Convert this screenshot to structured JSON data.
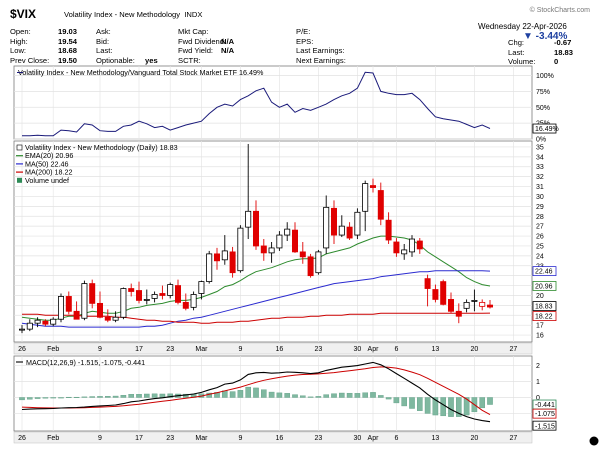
{
  "header": {
    "ticker": "$VIX",
    "name": "Volatility Index - New Methodology",
    "exchange": "INDX",
    "copyright": "© StockCharts.com",
    "date": "Wednesday  22-Apr-2026",
    "change_pct": "▼ -3.44%",
    "col1": [
      [
        "Open:",
        "19.03"
      ],
      [
        "High:",
        "19.54"
      ],
      [
        "Low:",
        "18.68"
      ],
      [
        "Prev Close:",
        "19.50"
      ]
    ],
    "col2": [
      [
        "Ask:",
        ""
      ],
      [
        "Bid:",
        ""
      ],
      [
        "Last:",
        ""
      ],
      [
        "Optionable:",
        "yes"
      ]
    ],
    "col3": [
      [
        "Mkt Cap:",
        ""
      ],
      [
        "Fwd Dividend:",
        "N/A"
      ],
      [
        "Fwd Yield:",
        "N/A"
      ],
      [
        "SCTR:",
        ""
      ]
    ],
    "col4": [
      [
        "P/E:",
        ""
      ],
      [
        "EPS:",
        ""
      ],
      [
        "Last Earnings:",
        ""
      ],
      [
        "Next Earnings:",
        ""
      ]
    ],
    "col5": [
      [
        "Chg:",
        "-0.67"
      ],
      [
        "Last:",
        "18.83"
      ],
      [
        "Volume:",
        "0"
      ]
    ]
  },
  "ratio_panel": {
    "legend": "Volatility Index - New Methodology/Vanguard Total Stock Market ETF 16.49%",
    "ticks": [
      "100%",
      "75%",
      "50%",
      "25%",
      "0%"
    ],
    "last_label": "16.49%"
  },
  "price_panel": {
    "legend": [
      "Volatility Index - New Methodology (Daily) 18.83",
      "EMA(20) 20.96",
      "MA(50) 22.46",
      "MA(200) 18.22",
      "Volume undef"
    ],
    "legend_colors": [
      "#000000",
      "#2e8b2e",
      "#2b2bd0",
      "#cc0000",
      "#2e8b57"
    ],
    "ticks": [
      "35",
      "34",
      "33",
      "32",
      "31",
      "30",
      "29",
      "28",
      "27",
      "26",
      "25",
      "24",
      "23",
      "22",
      "21",
      "20",
      "19",
      "18",
      "17",
      "16"
    ],
    "badges": [
      {
        "text": "22.46",
        "color": "#2b2bd0",
        "y": 22.46
      },
      {
        "text": "20.96",
        "color": "#2e8b2e",
        "y": 20.96
      },
      {
        "text": "18.83",
        "color": "#000000",
        "y": 18.83
      },
      {
        "text": "18.22",
        "color": "#cc0000",
        "y": 18.22
      }
    ]
  },
  "macd_panel": {
    "legend": [
      "MACD(12,26,9) -1.515, ",
      "-1.075, ",
      "-0.441"
    ],
    "legend_colors": [
      "#000000",
      "#cc0000",
      "#2e8b57"
    ],
    "ticks": [
      "2",
      "1",
      "0",
      "-1"
    ],
    "badges": [
      {
        "text": "-0.441",
        "color": "#2e8b57",
        "y": -0.441
      },
      {
        "text": "-1.075",
        "color": "#cc0000",
        "y": -1.075
      },
      {
        "text": "-1.515",
        "color": "#000000",
        "y": -1.515
      }
    ]
  },
  "x_axis": {
    "labels": [
      "26",
      "Feb",
      "9",
      "17",
      "23",
      "Mar",
      "9",
      "16",
      "23",
      "30",
      "Apr",
      "6",
      "13",
      "20",
      "27"
    ],
    "label_positions": [
      0,
      4,
      10,
      15,
      19,
      23,
      28,
      33,
      38,
      43,
      45,
      48,
      53,
      58,
      63
    ]
  },
  "chart_data": {
    "type": "candlestick",
    "title": "Volatility Index - New Methodology (Daily)",
    "ylim": [
      15.3,
      35.6
    ],
    "x": [
      "2026-01-26",
      "2026-01-27",
      "2026-01-28",
      "2026-01-29",
      "2026-01-30",
      "2026-02-02",
      "2026-02-03",
      "2026-02-04",
      "2026-02-05",
      "2026-02-06",
      "2026-02-09",
      "2026-02-10",
      "2026-02-11",
      "2026-02-12",
      "2026-02-13",
      "2026-02-17",
      "2026-02-18",
      "2026-02-19",
      "2026-02-20",
      "2026-02-23",
      "2026-02-24",
      "2026-02-25",
      "2026-02-26",
      "2026-02-27",
      "2026-03-02",
      "2026-03-03",
      "2026-03-04",
      "2026-03-05",
      "2026-03-06",
      "2026-03-09",
      "2026-03-10",
      "2026-03-11",
      "2026-03-12",
      "2026-03-13",
      "2026-03-16",
      "2026-03-17",
      "2026-03-18",
      "2026-03-19",
      "2026-03-20",
      "2026-03-23",
      "2026-03-24",
      "2026-03-25",
      "2026-03-26",
      "2026-03-27",
      "2026-03-30",
      "2026-03-31",
      "2026-04-01",
      "2026-04-02",
      "2026-04-06",
      "2026-04-07",
      "2026-04-08",
      "2026-04-09",
      "2026-04-10",
      "2026-04-13",
      "2026-04-14",
      "2026-04-15",
      "2026-04-16",
      "2026-04-17",
      "2026-04-20",
      "2026-04-21",
      "2026-04-22"
    ],
    "ohlc": [
      [
        16.5,
        17.0,
        16.2,
        16.6
      ],
      [
        16.6,
        17.6,
        16.4,
        17.2
      ],
      [
        17.2,
        17.8,
        16.8,
        17.5
      ],
      [
        17.4,
        17.6,
        16.9,
        17.1
      ],
      [
        17.1,
        17.8,
        16.9,
        17.6
      ],
      [
        17.6,
        20.2,
        17.3,
        19.9
      ],
      [
        19.9,
        20.4,
        18.1,
        18.4
      ],
      [
        18.4,
        19.4,
        17.6,
        17.6
      ],
      [
        17.7,
        21.5,
        17.5,
        21.2
      ],
      [
        21.2,
        21.6,
        18.7,
        19.2
      ],
      [
        19.2,
        20.4,
        17.7,
        17.8
      ],
      [
        17.8,
        18.6,
        17.3,
        17.5
      ],
      [
        17.5,
        18.4,
        17.3,
        17.8
      ],
      [
        17.8,
        20.8,
        17.6,
        20.7
      ],
      [
        20.7,
        21.2,
        19.9,
        20.4
      ],
      [
        20.5,
        21.4,
        19.2,
        19.5
      ],
      [
        19.5,
        20.6,
        19.1,
        19.6
      ],
      [
        19.7,
        20.4,
        19.3,
        20.1
      ],
      [
        20.2,
        21.0,
        19.6,
        20.0
      ],
      [
        20.0,
        21.3,
        19.7,
        21.1
      ],
      [
        21.0,
        21.6,
        19.1,
        19.3
      ],
      [
        19.3,
        20.2,
        18.5,
        18.7
      ],
      [
        18.8,
        20.4,
        18.5,
        20.1
      ],
      [
        20.2,
        21.5,
        19.6,
        21.4
      ],
      [
        21.4,
        24.5,
        21.2,
        24.2
      ],
      [
        24.2,
        24.8,
        22.6,
        23.5
      ],
      [
        23.6,
        26.1,
        23.1,
        24.5
      ],
      [
        24.4,
        24.9,
        21.8,
        22.3
      ],
      [
        22.5,
        27.1,
        22.3,
        26.8
      ],
      [
        26.9,
        35.3,
        25.7,
        28.5
      ],
      [
        28.5,
        29.6,
        24.6,
        25.0
      ],
      [
        25.0,
        25.7,
        23.5,
        24.3
      ],
      [
        24.3,
        25.4,
        23.3,
        24.8
      ],
      [
        24.8,
        26.5,
        24.5,
        26.1
      ],
      [
        26.1,
        27.4,
        25.5,
        26.7
      ],
      [
        26.6,
        27.4,
        24.3,
        24.4
      ],
      [
        24.4,
        25.4,
        23.2,
        23.9
      ],
      [
        23.9,
        24.2,
        21.8,
        22.0
      ],
      [
        22.3,
        24.6,
        22.1,
        24.4
      ],
      [
        24.8,
        30.1,
        24.2,
        28.9
      ],
      [
        28.8,
        29.6,
        25.2,
        26.1
      ],
      [
        26.1,
        28.1,
        25.9,
        27.0
      ],
      [
        26.9,
        27.4,
        25.6,
        25.8
      ],
      [
        26.1,
        28.8,
        25.7,
        28.4
      ],
      [
        28.5,
        31.6,
        26.5,
        31.3
      ],
      [
        31.1,
        31.8,
        30.4,
        30.9
      ],
      [
        30.6,
        31.4,
        27.1,
        27.7
      ],
      [
        27.6,
        28.4,
        25.2,
        25.6
      ],
      [
        25.4,
        25.8,
        23.9,
        24.3
      ],
      [
        24.2,
        25.2,
        23.6,
        24.6
      ],
      [
        24.4,
        26.1,
        23.9,
        25.7
      ],
      [
        25.5,
        25.8,
        24.2,
        24.7
      ],
      [
        21.7,
        22.1,
        18.9,
        20.7
      ],
      [
        20.6,
        21.1,
        19.3,
        19.6
      ],
      [
        21.4,
        21.6,
        19.0,
        19.1
      ],
      [
        19.6,
        20.3,
        18.2,
        18.4
      ],
      [
        18.4,
        19.2,
        17.2,
        17.9
      ],
      [
        18.7,
        19.6,
        18.3,
        19.3
      ],
      [
        19.4,
        20.6,
        18.4,
        19.5
      ],
      [
        18.9,
        19.6,
        18.5,
        19.3
      ],
      [
        19.03,
        19.54,
        18.68,
        18.83
      ]
    ],
    "series": [
      {
        "name": "EMA(20)",
        "values": [
          17.8,
          17.7,
          17.6,
          17.5,
          17.5,
          17.7,
          17.9,
          17.9,
          18.2,
          18.4,
          18.3,
          18.2,
          18.2,
          18.4,
          18.7,
          18.8,
          19.0,
          19.1,
          19.2,
          19.4,
          19.5,
          19.5,
          19.6,
          19.8,
          20.1,
          20.4,
          20.9,
          21.1,
          21.5,
          22.0,
          22.4,
          22.6,
          22.8,
          23.1,
          23.4,
          23.6,
          23.7,
          23.7,
          23.8,
          24.2,
          24.4,
          24.6,
          24.8,
          25.2,
          25.5,
          25.8,
          26.0,
          26.0,
          25.9,
          25.8,
          25.6,
          25.1,
          24.4,
          23.9,
          23.4,
          22.9,
          22.4,
          21.8,
          21.4,
          21.1,
          20.96
        ]
      },
      {
        "name": "MA(50)",
        "values": [
          17.2,
          17.1,
          17.0,
          16.9,
          16.9,
          16.9,
          16.8,
          16.8,
          16.8,
          16.8,
          16.8,
          16.8,
          16.8,
          16.8,
          16.8,
          16.8,
          16.9,
          16.9,
          17.0,
          17.2,
          17.4,
          17.5,
          17.7,
          17.8,
          18.0,
          18.2,
          18.4,
          18.6,
          18.8,
          19.0,
          19.2,
          19.4,
          19.6,
          19.8,
          20.0,
          20.2,
          20.4,
          20.6,
          20.8,
          21.0,
          21.2,
          21.3,
          21.4,
          21.5,
          21.6,
          21.7,
          21.9,
          22.0,
          22.1,
          22.2,
          22.3,
          22.4,
          22.4,
          22.5,
          22.5,
          22.5,
          22.5,
          22.5,
          22.5,
          22.5,
          22.46
        ]
      },
      {
        "name": "MA(200)",
        "values": [
          18.1,
          18.1,
          18.1,
          18.0,
          18.0,
          18.0,
          18.0,
          18.0,
          17.9,
          17.9,
          17.9,
          17.9,
          17.8,
          17.8,
          17.7,
          17.6,
          17.5,
          17.5,
          17.4,
          17.4,
          17.3,
          17.3,
          17.3,
          17.2,
          17.2,
          17.3,
          17.3,
          17.3,
          17.4,
          17.4,
          17.5,
          17.6,
          17.7,
          17.7,
          17.8,
          17.8,
          17.8,
          17.9,
          17.9,
          18.0,
          18.0,
          18.0,
          18.1,
          18.1,
          18.1,
          18.1,
          18.2,
          18.2,
          18.2,
          18.2,
          18.2,
          18.2,
          18.2,
          18.2,
          18.2,
          18.2,
          18.2,
          18.2,
          18.2,
          18.2,
          18.22
        ]
      }
    ],
    "ratio": {
      "name": "Volatility Index - New Methodology/Vanguard Total Stock Market ETF",
      "unit": "%",
      "ylim": [
        0,
        115
      ],
      "values": [
        5,
        5,
        6,
        5,
        5,
        14,
        13,
        11,
        24,
        22,
        13,
        12,
        12,
        20,
        22,
        28,
        24,
        18,
        20,
        14,
        18,
        22,
        25,
        28,
        40,
        50,
        55,
        52,
        62,
        68,
        76,
        80,
        58,
        50,
        55,
        42,
        48,
        45,
        50,
        55,
        62,
        68,
        72,
        80,
        105,
        104,
        75,
        72,
        70,
        70,
        72,
        62,
        48,
        35,
        32,
        30,
        28,
        23,
        18,
        22,
        16.49
      ]
    },
    "macd": {
      "name": "MACD(12,26,9)",
      "ylim": [
        -2.1,
        2.6
      ],
      "macd": [
        -0.75,
        -0.73,
        -0.71,
        -0.7,
        -0.69,
        -0.66,
        -0.64,
        -0.63,
        -0.6,
        -0.56,
        -0.53,
        -0.5,
        -0.47,
        -0.38,
        -0.27,
        -0.22,
        -0.14,
        -0.07,
        -0.02,
        0.05,
        0.11,
        0.16,
        0.22,
        0.32,
        0.48,
        0.62,
        0.84,
        0.9,
        1.1,
        1.45,
        1.55,
        1.57,
        1.52,
        1.55,
        1.6,
        1.58,
        1.55,
        1.5,
        1.55,
        1.7,
        1.8,
        1.9,
        1.95,
        2.0,
        2.1,
        2.2,
        2.05,
        1.8,
        1.5,
        1.2,
        0.9,
        0.6,
        0.2,
        -0.15,
        -0.45,
        -0.75,
        -1.0,
        -1.2,
        -1.35,
        -1.45,
        -1.515
      ],
      "signal": [
        -0.6,
        -0.62,
        -0.64,
        -0.65,
        -0.66,
        -0.66,
        -0.66,
        -0.65,
        -0.64,
        -0.62,
        -0.6,
        -0.58,
        -0.56,
        -0.52,
        -0.47,
        -0.42,
        -0.36,
        -0.3,
        -0.24,
        -0.18,
        -0.11,
        -0.05,
        0.01,
        0.09,
        0.2,
        0.3,
        0.42,
        0.53,
        0.65,
        0.8,
        0.95,
        1.08,
        1.18,
        1.26,
        1.34,
        1.4,
        1.44,
        1.46,
        1.48,
        1.52,
        1.56,
        1.62,
        1.68,
        1.74,
        1.8,
        1.88,
        1.92,
        1.9,
        1.84,
        1.73,
        1.59,
        1.43,
        1.2,
        0.95,
        0.7,
        0.45,
        0.2,
        -0.1,
        -0.45,
        -0.8,
        -1.075
      ],
      "hist": [
        -0.15,
        -0.11,
        -0.07,
        -0.05,
        -0.03,
        0.0,
        0.02,
        0.02,
        0.04,
        0.06,
        0.07,
        0.08,
        0.09,
        0.14,
        0.2,
        0.2,
        0.22,
        0.23,
        0.22,
        0.23,
        0.22,
        0.21,
        0.21,
        0.23,
        0.28,
        0.32,
        0.42,
        0.37,
        0.45,
        0.65,
        0.6,
        0.49,
        0.34,
        0.29,
        0.26,
        0.18,
        0.11,
        0.04,
        0.07,
        0.18,
        0.24,
        0.28,
        0.27,
        0.26,
        0.3,
        0.32,
        0.13,
        -0.1,
        -0.34,
        -0.53,
        -0.69,
        -0.83,
        -1.0,
        -1.1,
        -1.15,
        -1.2,
        -1.2,
        -1.1,
        -0.9,
        -0.65,
        -0.441
      ]
    }
  }
}
